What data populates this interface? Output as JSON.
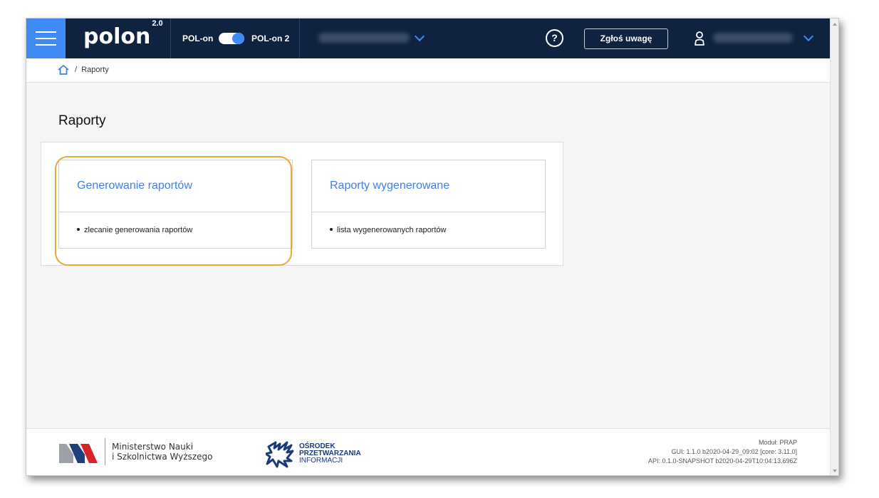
{
  "header": {
    "logo_text": "polon",
    "logo_version": "2.0",
    "system_left_label": "POL-on",
    "system_right_label": "POL-on 2",
    "help_label": "?",
    "report_button_label": "Zgłoś uwagę",
    "icons": {
      "menu": "hamburger-menu-icon",
      "help": "question-circle-icon",
      "user": "user-icon",
      "dropdown": "chevron-down-icon"
    }
  },
  "breadcrumb": {
    "current": "Raporty",
    "separator": "/"
  },
  "main": {
    "title": "Raporty",
    "tiles": [
      {
        "title": "Generowanie raportów",
        "items": [
          "zlecanie generowania raportów"
        ]
      },
      {
        "title": "Raporty wygenerowane",
        "items": [
          "lista wygenerowanych raportów"
        ]
      }
    ]
  },
  "footer": {
    "ministry_line1": "Ministerstwo Nauki",
    "ministry_line2": "i Szkolnictwa Wyższego",
    "opi_line1": "OŚRODEK",
    "opi_line2": "PRZETWARZANIA",
    "opi_line3": "INFORMACJI",
    "module": "Moduł: PRAP",
    "gui": "GUI: 1.1.0 b2020-04-29_09:02 [core: 3.11.0]",
    "api": "API: 0.1.0-SNAPSHOT b2020-04-29T10:04:13.696Z"
  },
  "colors": {
    "topbar": "#0f2340",
    "accent": "#3f8bf5",
    "link": "#3f7fe6",
    "highlight": "#e6a93a"
  }
}
